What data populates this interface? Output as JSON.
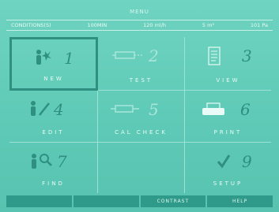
{
  "screen": {
    "title": "MENU"
  },
  "status": {
    "item1": "CONDITIONS(S)",
    "item2": "100MIN",
    "item3": "120 ml/h",
    "item4": "5 m³",
    "item5": "101 Pa"
  },
  "menu": [
    {
      "number": "1",
      "label": "NEW",
      "icon": "person-icon",
      "selected": true
    },
    {
      "number": "2",
      "label": "TEST",
      "icon": "syringe-icon",
      "selected": false
    },
    {
      "number": "3",
      "label": "VIEW",
      "icon": "document-icon",
      "selected": false
    },
    {
      "number": "4",
      "label": "EDIT",
      "icon": "person-edit-icon",
      "selected": false
    },
    {
      "number": "5",
      "label": "CAL CHECK",
      "icon": "calibration-icon",
      "selected": false
    },
    {
      "number": "6",
      "label": "PRINT",
      "icon": "printer-icon",
      "selected": false
    },
    {
      "number": "7",
      "label": "FIND",
      "icon": "search-person-icon",
      "selected": false
    },
    {
      "number": "9",
      "label": "SETUP",
      "icon": "checkmark-icon",
      "selected": false
    }
  ],
  "softkeys": [
    "",
    "",
    "CONTRAST",
    "HELP"
  ],
  "colors": {
    "background": "#5fcbb8",
    "accent": "#2f8f80",
    "text_light": "#e8fbf6"
  }
}
